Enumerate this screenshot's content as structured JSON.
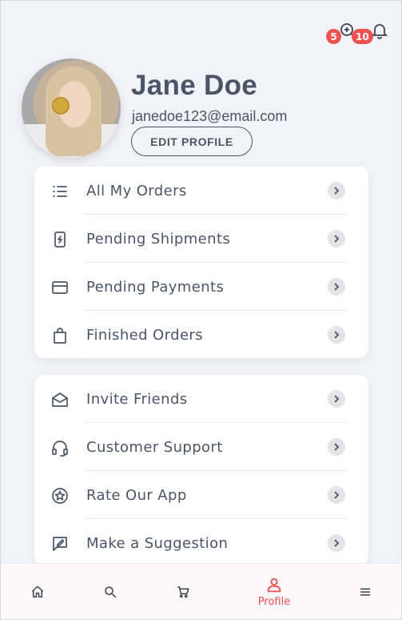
{
  "header": {
    "search_plus_badge": "5",
    "notifications_badge": "10"
  },
  "profile": {
    "name": "Jane Doe",
    "email": "janedoe123@email.com",
    "edit_button": "EDIT PROFILE"
  },
  "orders_menu": [
    {
      "label": "All My Orders",
      "icon": "list-icon"
    },
    {
      "label": "Pending Shipments",
      "icon": "phone-charging-icon"
    },
    {
      "label": "Pending Payments",
      "icon": "credit-card-icon"
    },
    {
      "label": "Finished Orders",
      "icon": "shopping-bag-icon"
    }
  ],
  "other_menu": [
    {
      "label": "Invite Friends",
      "icon": "open-mail-icon"
    },
    {
      "label": "Customer Support",
      "icon": "headset-icon"
    },
    {
      "label": "Rate Our App",
      "icon": "star-circle-icon"
    },
    {
      "label": "Make a Suggestion",
      "icon": "edit-note-icon"
    }
  ],
  "bottom_nav": {
    "items": [
      "home-icon",
      "search-icon",
      "cart-icon",
      "profile-icon",
      "menu-icon"
    ],
    "active_label": "Profile",
    "accent_color": "#f0524f"
  }
}
